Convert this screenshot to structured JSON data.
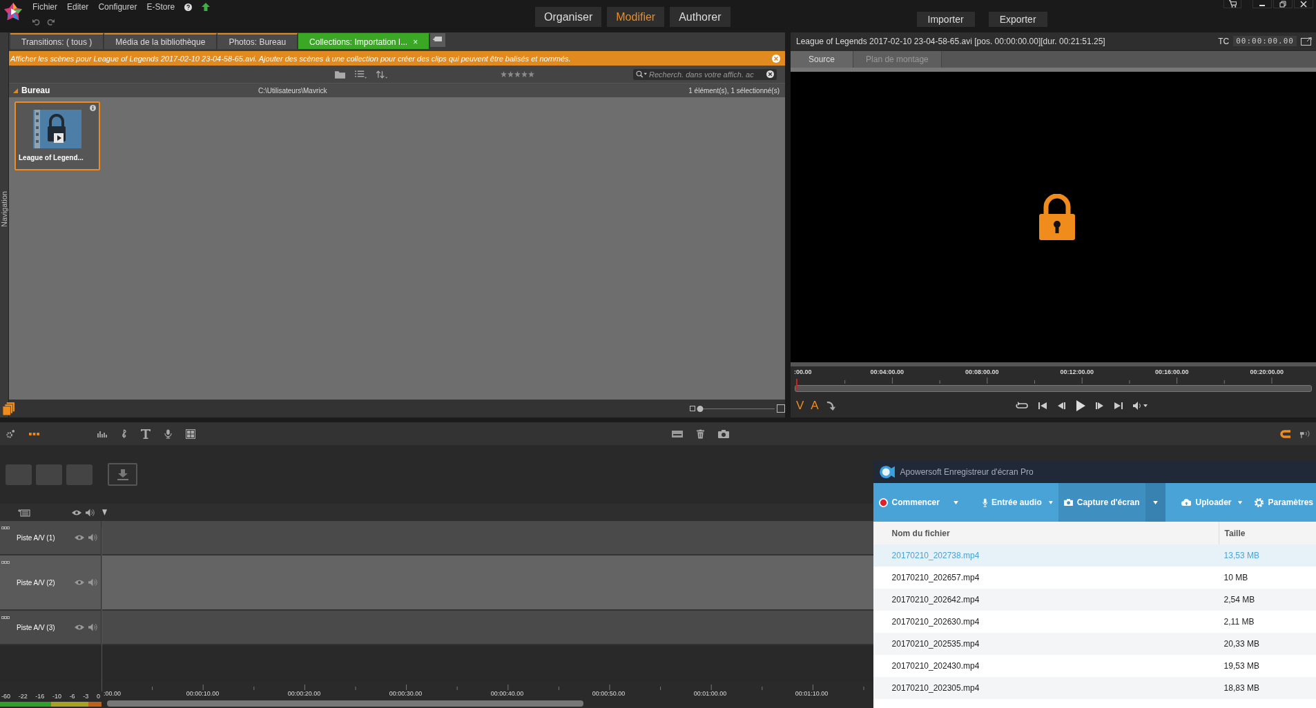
{
  "menu": [
    {
      "label": "Fichier"
    },
    {
      "label": "Editer"
    },
    {
      "label": "Configurer"
    },
    {
      "label": "E-Store"
    }
  ],
  "modes": [
    {
      "label": "Organiser",
      "selected": false
    },
    {
      "label": "Modifier",
      "selected": true
    },
    {
      "label": "Authorer",
      "selected": false
    }
  ],
  "actions": [
    "Importer",
    "Exporter"
  ],
  "library": {
    "side_tab": "Navigation",
    "tabs": [
      {
        "label": "Transitions: ( tous )",
        "selected": false
      },
      {
        "label": "Média de la bibliothèque",
        "selected": false
      },
      {
        "label": "Photos: Bureau",
        "selected": false
      },
      {
        "label": "Collections: Importation I...",
        "selected": true,
        "close": "×"
      }
    ],
    "info": "Afficher les scènes pour League of Legends 2017-02-10 23-04-58-65.avi. Ajouter des scènes à une collection pour créer des clips qui peuvent être balisés et nommés.",
    "stars": 0,
    "search": {
      "placeholder": "Recherch. dans votre affich. ac"
    },
    "folder": "Bureau",
    "path": "C:\\Utilisateurs\\Mavrick",
    "count": "1 élément(s), 1 sélectionné(s)",
    "items": [
      {
        "title": "League of Legend...",
        "selected": true
      }
    ],
    "zoom": {
      "level": 0.04
    }
  },
  "player": {
    "title": "League of Legends 2017-02-10 23-04-58-65.avi [pos. 00:00:00.00][dur. 00:21:51.25]",
    "tc_label": "TC",
    "timecode": "00:00:00.00",
    "tabs": [
      {
        "label": "Source",
        "selected": true
      },
      {
        "label": "Plan de montage",
        "selected": false
      }
    ],
    "ruler": [
      ":00.00",
      "00:04:00.00",
      "00:08:00.00",
      "00:12:00.00",
      "00:16:00.00",
      "00:20:00.00"
    ],
    "toggles": [
      "V",
      "A"
    ]
  },
  "timeline": {
    "tracks": [
      {
        "name": "Piste A/V (1)",
        "selected": false
      },
      {
        "name": "Piste A/V (2)",
        "selected": true
      },
      {
        "name": "Piste A/V (3)",
        "selected": false
      }
    ],
    "ruler": [
      ":00.00",
      "00:00:10.00",
      "00:00:20.00",
      "00:00:30.00",
      "00:00:40.00",
      "00:00:50.00",
      "00:01:00.00",
      "00:01:10.00"
    ],
    "meter_labels": [
      "-60",
      "-22",
      "-16",
      "-10",
      "-6",
      "-3",
      "0"
    ]
  },
  "recorder": {
    "title": "Apowersoft Enregistreur d'écran Pro",
    "toolbar": [
      {
        "kind": "record",
        "label": "Commencer",
        "selected": false
      },
      {
        "kind": "mic",
        "label": "Entrée audio",
        "selected": false
      },
      {
        "kind": "camera",
        "label": "Capture d'écran",
        "selected": true
      },
      {
        "kind": "upload",
        "label": "Uploader",
        "selected": false
      },
      {
        "kind": "settings",
        "label": "Paramètres",
        "selected": false
      }
    ],
    "columns": [
      "Nom du fichier",
      "Taille"
    ],
    "rows": [
      {
        "name": "20170210_202738.mp4",
        "size": "13,53 MB",
        "selected": true
      },
      {
        "name": "20170210_202657.mp4",
        "size": "10 MB",
        "selected": false
      },
      {
        "name": "20170210_202642.mp4",
        "size": "2,54 MB",
        "selected": false
      },
      {
        "name": "20170210_202630.mp4",
        "size": "2,11 MB",
        "selected": false
      },
      {
        "name": "20170210_202535.mp4",
        "size": "20,33 MB",
        "selected": false
      },
      {
        "name": "20170210_202430.mp4",
        "size": "19,53 MB",
        "selected": false
      },
      {
        "name": "20170210_202305.mp4",
        "size": "18,83 MB",
        "selected": false
      }
    ]
  }
}
